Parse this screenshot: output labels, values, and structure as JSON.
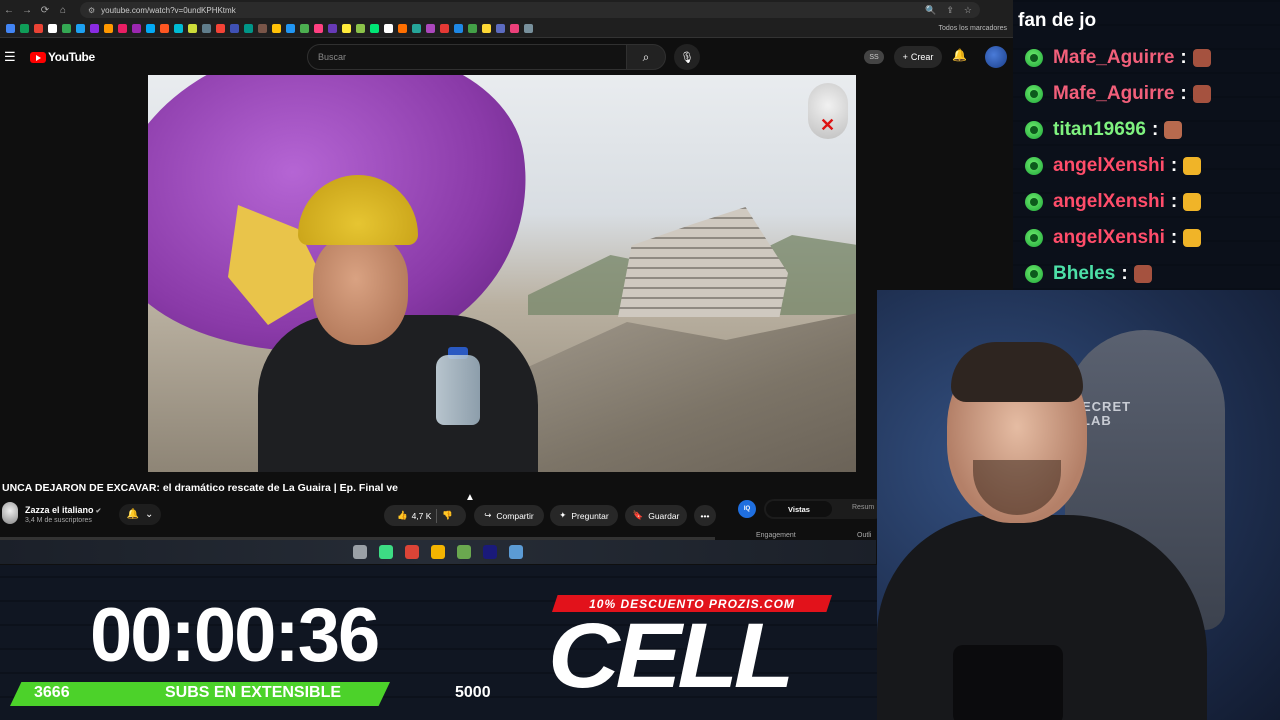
{
  "browser": {
    "url": "youtube.com/watch?v=0undKPHKtmk",
    "bookmarks_all": "Todos los marcadores",
    "bookmark_colors": [
      "#4285f4",
      "#0f9d58",
      "#ea4335",
      "#ffffff",
      "#34a853",
      "#1da1f2",
      "#8a2be2",
      "#ff9800",
      "#e91e63",
      "#9c27b0",
      "#03a9f4",
      "#ff5722",
      "#00bcd4",
      "#cddc39",
      "#607d8b",
      "#f44336",
      "#3f51b5",
      "#009688",
      "#795548",
      "#ffc107",
      "#2196f3",
      "#4caf50",
      "#ff4081",
      "#673ab7",
      "#ffeb3b",
      "#8bc34a",
      "#00e676",
      "#ffffff",
      "#ff6f00",
      "#26a69a",
      "#ab47bc",
      "#e53935",
      "#1e88e5",
      "#43a047",
      "#fdd835",
      "#5c6bc0",
      "#ec407a",
      "#78909c"
    ]
  },
  "youtube": {
    "logo_text": "YouTube",
    "search_placeholder": "Buscar",
    "ss_badge": "SS",
    "create_label": "Crear",
    "video": {
      "title": "UNCA DEJARON DE EXCAVAR: el dramático rescate de La Guaira | Ep. Final ve",
      "channel_name": "Zazza el italiano",
      "channel_subs": "3,4 M de suscriptores",
      "likes": "4,7 K",
      "share_label": "Compartir",
      "ask_label": "Preguntar",
      "save_label": "Guardar"
    },
    "side_panel": {
      "icon_text": "IQ",
      "tab_active": "Vistas",
      "tab_other": "Resum",
      "engagement": "Engagement",
      "outliers": "Outli"
    }
  },
  "taskbar": {
    "app_colors": [
      "#9aa0a6",
      "#3ddc84",
      "#db4437",
      "#f4b400",
      "#6aa84f",
      "#1a1a7a",
      "#5b9bd5"
    ]
  },
  "chat": {
    "header": "fan de jo",
    "messages": [
      {
        "user": "Mafe_Aguirre",
        "color": "#f25f7a",
        "emote": "#a5523f"
      },
      {
        "user": "Mafe_Aguirre",
        "color": "#f25f7a",
        "emote": "#a5523f"
      },
      {
        "user": "titan19696",
        "color": "#7ff27f",
        "emote": "#b86a4e"
      },
      {
        "user": "angelXenshi",
        "color": "#ff4d6a",
        "emote": "#f0b428"
      },
      {
        "user": "angelXenshi",
        "color": "#ff4d6a",
        "emote": "#f0b428"
      },
      {
        "user": "angelXenshi",
        "color": "#ff4d6a",
        "emote": "#f0b428"
      },
      {
        "user": "Bheles",
        "color": "#4de0a8",
        "emote": "#a5523f"
      }
    ]
  },
  "webcam": {
    "chair_text": "ECRET\nLAB"
  },
  "overlay": {
    "timer": "00:00:36",
    "subs_current": "3666",
    "subs_label": "SUBS EN EXTENSIBLE",
    "subs_goal": "5000",
    "progress_fraction": 0.733
  },
  "sponsor": {
    "promo": "10% DESCUENTO PROZIS.COM",
    "brand": "CELL"
  }
}
